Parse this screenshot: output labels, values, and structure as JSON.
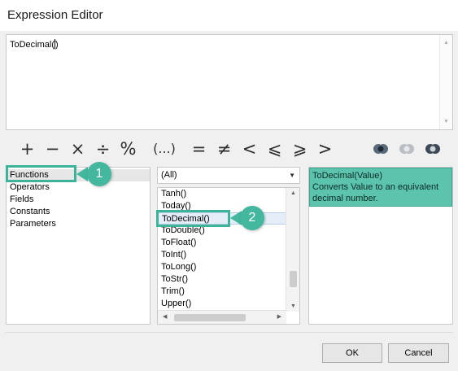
{
  "dialog": {
    "title": "Expression Editor"
  },
  "editor": {
    "expression": "ToDecimal(",
    "expression_tail": ")"
  },
  "operators": [
    "+",
    "−",
    "×",
    "÷",
    "%",
    "(...)",
    "=",
    "≠",
    "<",
    "⩽",
    "⩾",
    ">"
  ],
  "categories": {
    "items": [
      "Functions",
      "Operators",
      "Fields",
      "Constants",
      "Parameters"
    ],
    "selected": "Functions"
  },
  "filter": {
    "selected": "(All)",
    "arrow": "▼"
  },
  "functions": {
    "items": [
      "Tanh()",
      "Today()",
      "ToDecimal()",
      "ToDouble()",
      "ToFloat()",
      "ToInt()",
      "ToLong()",
      "ToStr()",
      "Trim()",
      "Upper()"
    ],
    "selected": "ToDecimal()"
  },
  "description": {
    "signature": "ToDecimal(Value)",
    "text": "Converts Value to an equivalent decimal number."
  },
  "callouts": [
    "1",
    "2"
  ],
  "buttons": {
    "ok": "OK",
    "cancel": "Cancel"
  },
  "colors": {
    "accent": "#3db39a",
    "description_bg": "#5cc4ac"
  }
}
